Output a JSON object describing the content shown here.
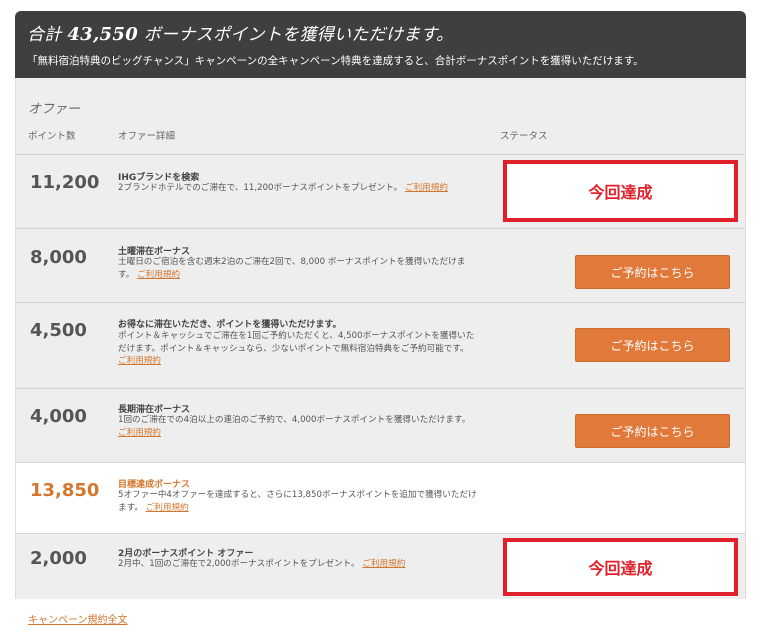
{
  "header": {
    "title_prefix": "合計",
    "title_points": "43,550",
    "title_suffix": "ボーナスポイントを獲得いただけます。",
    "subtitle": "「無料宿泊特典のビッグチャンス」キャンペーンの全キャンペーン特典を達成すると、合計ボーナスポイントを獲得いただけます。"
  },
  "section": {
    "heading": "オファー",
    "col_points": "ポイント数",
    "col_details": "オファー詳細",
    "col_status": "ステータス"
  },
  "rows": [
    {
      "points": "11,200",
      "title": "IHGブランドを検索",
      "text": "2ブランドホテルでのご滞在で、11,200ボーナスポイントをプレゼント。",
      "link": "ご利用規約",
      "status": "今回達成"
    },
    {
      "points": "8,000",
      "title": "土曜滞在ボーナス",
      "text": "土曜日のご宿泊を含む週末2泊のご滞在2回で、8,000 ボーナスポイントを獲得いただけます。",
      "link": "ご利用規約",
      "button": "ご予約はこちら"
    },
    {
      "points": "4,500",
      "title": "お得なに滞在いただき、ポイントを獲得いただけます。",
      "text": "ポイント＆キャッシュでご滞在を1回ご予約いただくと、4,500ボーナスポイントを獲得いただけます。ポイント＆キャッシュなら、少ないポイントで無料宿泊特典をご予約可能です。",
      "link": "ご利用規約",
      "button": "ご予約はこちら"
    },
    {
      "points": "4,000",
      "title": "長期滞在ボーナス",
      "text": "1回のご滞在での4泊以上の連泊のご予約で、4,000ボーナスポイントを獲得いただけます。",
      "link": "ご利用規約",
      "button": "ご予約はこちら"
    },
    {
      "points": "13,850",
      "title": "目標達成ボーナス",
      "text": "5オファー中4オファーを達成すると、さらに13,850ボーナスポイントを追加で獲得いただけます。",
      "link": "ご利用規約"
    },
    {
      "points": "2,000",
      "title": "2月のボーナスポイント オファー",
      "text": "2月中、1回のご滞在で2,000ボーナスポイントをプレゼント。",
      "link": "ご利用規約",
      "status": "今回達成"
    }
  ],
  "footer": {
    "terms_link": "キャンペーン規約全文"
  },
  "colors": {
    "header_bg": "#3f3f3f",
    "accent_orange": "#e0793a",
    "achieved_red": "#e0202a",
    "panel_bg": "#eeeeee"
  }
}
